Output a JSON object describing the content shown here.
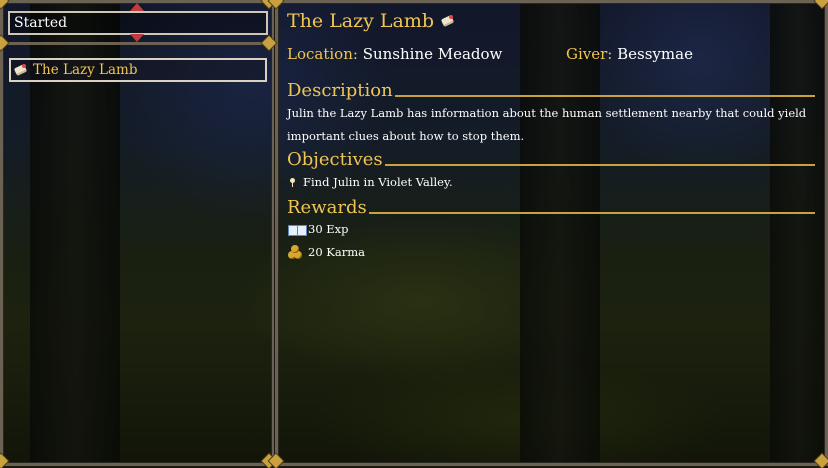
{
  "filter": {
    "selected": "Started"
  },
  "quest_list": [
    {
      "title": "The Lazy Lamb",
      "icon": "scroll-icon"
    }
  ],
  "quest": {
    "title": "The Lazy Lamb",
    "title_icon": "scroll-icon",
    "location_label": "Location:",
    "location": "Sunshine Meadow",
    "giver_label": "Giver:",
    "giver": "Bessymae",
    "description_heading": "Description",
    "description": "Julin the Lazy Lamb has information about the human settlement nearby that could yield important clues about how to stop them.",
    "objectives_heading": "Objectives",
    "objectives": [
      {
        "text": "Find Julin in Violet Valley.",
        "icon": "pin-icon"
      }
    ],
    "rewards_heading": "Rewards",
    "rewards": [
      {
        "text": "30 Exp",
        "icon": "book-icon"
      },
      {
        "text": "20 Karma",
        "icon": "coin-icon"
      }
    ]
  },
  "colors": {
    "accent": "#f0c552",
    "frame": "#6b6253",
    "text": "#ffffff",
    "arrow": "#c23b3b"
  }
}
